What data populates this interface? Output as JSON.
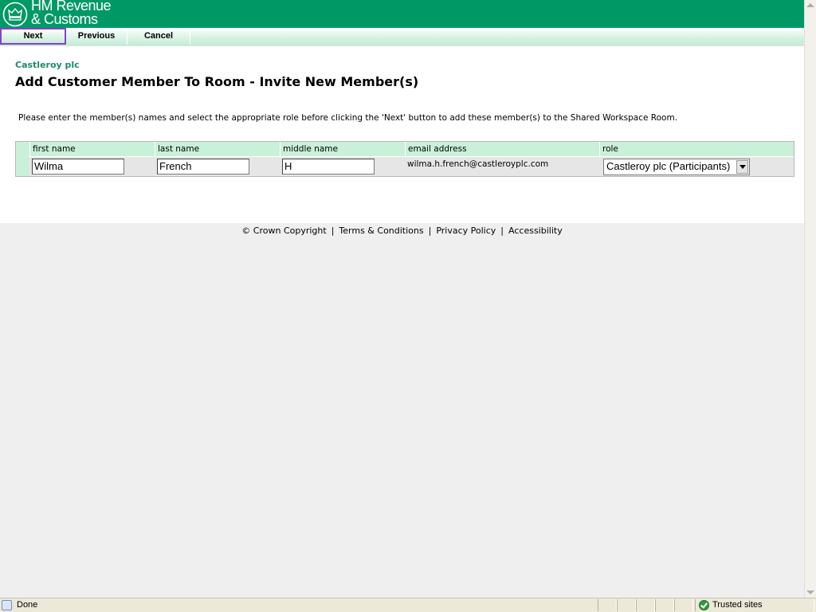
{
  "header": {
    "logo_line1": "HM Revenue",
    "logo_line2": "& Customs",
    "brand_color": "#009966"
  },
  "toolbar": {
    "next_label": "Next",
    "previous_label": "Previous",
    "cancel_label": "Cancel",
    "focus_outline_color": "#8a3fd1"
  },
  "main": {
    "organisation": "Castleroy plc",
    "title": "Add Customer Member To Room - Invite New Member(s)",
    "instructions": "Please enter the member(s) names and select the appropriate role before clicking the 'Next' button to add these member(s) to the Shared Workspace Room."
  },
  "grid": {
    "columns": [
      "first name",
      "last name",
      "middle name",
      "email address",
      "role"
    ],
    "row": {
      "first_name": "Wilma",
      "last_name": "French",
      "middle_name": "H",
      "email": "wilma.h.french@castleroyplc.com",
      "role": "Castleroy plc (Participants)"
    }
  },
  "footer": {
    "copyright": "© Crown Copyright",
    "terms": "Terms & Conditions",
    "privacy": "Privacy Policy",
    "accessibility": "Accessibility",
    "separator": "|"
  },
  "statusbar": {
    "status": "Done",
    "zone": "Trusted sites",
    "icons": [
      "page-done-icon",
      "trusted-zone-icon"
    ]
  }
}
